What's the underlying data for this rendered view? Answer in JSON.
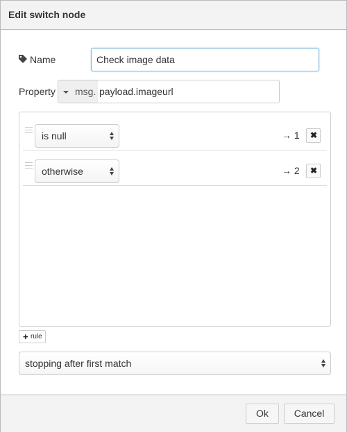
{
  "dialog": {
    "title": "Edit switch node"
  },
  "name": {
    "label": "Name",
    "value": "Check image data"
  },
  "property": {
    "label": "Property",
    "type": "msg.",
    "value": "payload.imageurl"
  },
  "rules": [
    {
      "operator": "is null",
      "output": "→ 1",
      "delete": "✖"
    },
    {
      "operator": "otherwise",
      "output": "→ 2",
      "delete": "✖"
    }
  ],
  "add_rule": {
    "icon": "+",
    "label": "rule"
  },
  "check_mode": "stopping after first match",
  "footer": {
    "ok": "Ok",
    "cancel": "Cancel"
  },
  "icons": {
    "name": "tag-icon",
    "drag": "drag-handle-icon",
    "select": "updown-arrows-icon"
  }
}
